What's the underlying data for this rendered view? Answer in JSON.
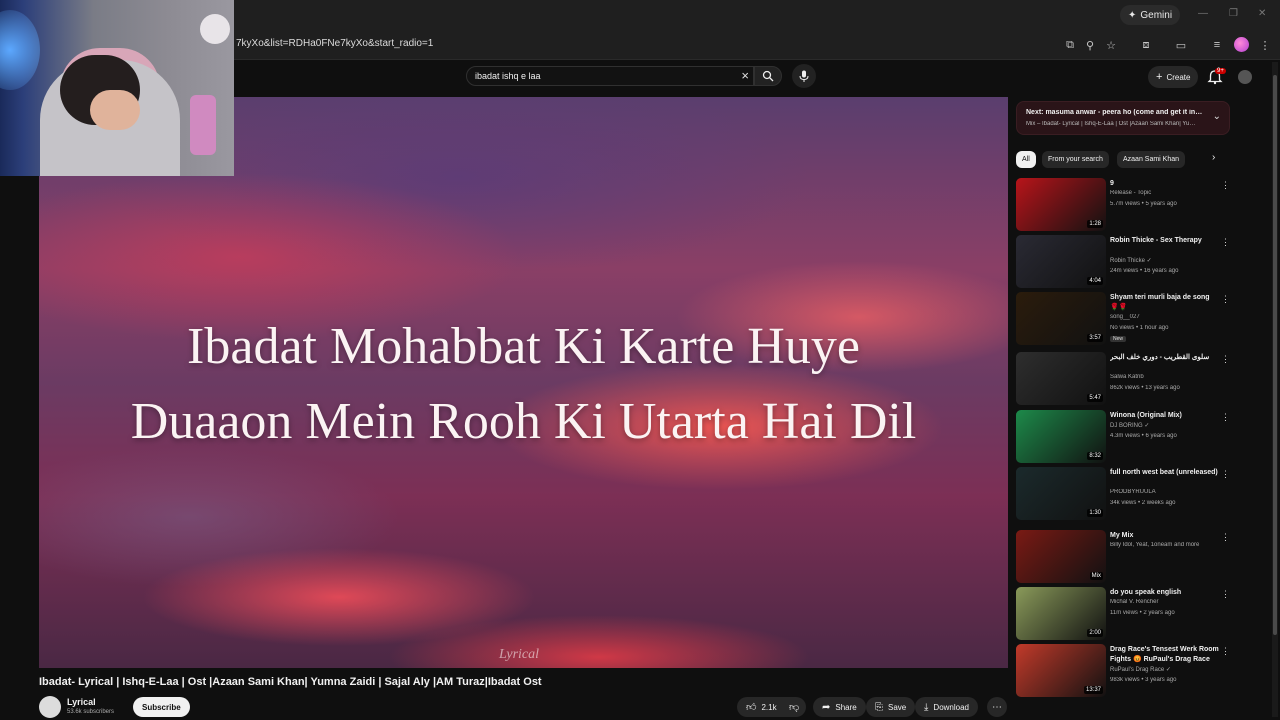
{
  "browser": {
    "url": "7kyXo&list=RDHa0FNe7kyXo&start_radio=1",
    "gemini_label": "Gemini"
  },
  "header": {
    "search_value": "ibadat ishq e laa",
    "create_label": "Create",
    "notification_badge": "9+"
  },
  "video": {
    "lyric_line1": "Ibadat Mohabbat Ki Karte Huye",
    "lyric_line2": "Duaaon Mein Rooh Ki Utarta Hai Dil",
    "watermark": "Lyrical",
    "title": "Ibadat- Lyrical | Ishq-E-Laa | Ost |Azaan Sami Khan| Yumna Zaidi | Sajal Aly |AM Turaz|Ibadat Ost",
    "channel_name": "Lyrical",
    "channel_subs": "53.6k subscribers",
    "subscribe_label": "Subscribe",
    "likes": "2.1k",
    "share_label": "Share",
    "save_label": "Save",
    "download_label": "Download"
  },
  "sidebar": {
    "up_next_title": "Next: masuma anwar - peera ho (come and get it in…",
    "up_next_sub": "Mix – Ibadat- Lyrical | Ishq-E-Laa | Ost |Azaan Sami Khan| Yu…",
    "chips": [
      "All",
      "From your search",
      "Azaan Sami Khan"
    ],
    "recommendations": [
      {
        "title": "9",
        "channel": "Release - Topic",
        "meta": "5.7m views • 5 years ago",
        "duration": "1:28",
        "thumb_color": "#b8141a"
      },
      {
        "title": "Robin Thicke - Sex Therapy",
        "channel": "Robin Thicke ✓",
        "meta": "24m views • 16 years ago",
        "duration": "4:04",
        "thumb_color": "#2a2a34"
      },
      {
        "title": "Shyam teri murli baja de song 🌹🌹",
        "channel": "song__027",
        "meta": "No views • 1 hour ago",
        "badge": "New",
        "duration": "3:57",
        "thumb_color": "#2b1c0c"
      },
      {
        "title": "سلوى القطريب - دوري خلف البحر",
        "channel": "Salwa Katrib",
        "meta": "862k views • 13 years ago",
        "duration": "5:47",
        "thumb_color": "#2e2e2e"
      },
      {
        "title": "Winona (Original Mix)",
        "channel": "DJ BORING ✓",
        "meta": "4.3m views • 6 years ago",
        "duration": "8:32",
        "thumb_color": "#1d8a4a"
      },
      {
        "title": "full north west beat (unreleased)",
        "channel": "PRODBYRUULA",
        "meta": "34k views • 2 weeks ago",
        "duration": "1:30",
        "thumb_color": "#1b2a2c"
      },
      {
        "title": "My Mix",
        "channel": "Billy Idol, Yeat, 1oneam and more",
        "meta": "",
        "duration": "Mix",
        "thumb_color": "#7a1a14"
      },
      {
        "title": "do you speak english",
        "channel": "Michal V. Rencher",
        "meta": "11m views • 2 years ago",
        "duration": "2:00",
        "thumb_color": "#8a9a5a"
      },
      {
        "title": "Drag Race's Tensest Werk Room Fights 😡 RuPaul's Drag Race",
        "channel": "RuPaul's Drag Race ✓",
        "meta": "983k views • 3 years ago",
        "duration": "13:37",
        "thumb_color": "#c23a2a"
      }
    ]
  }
}
